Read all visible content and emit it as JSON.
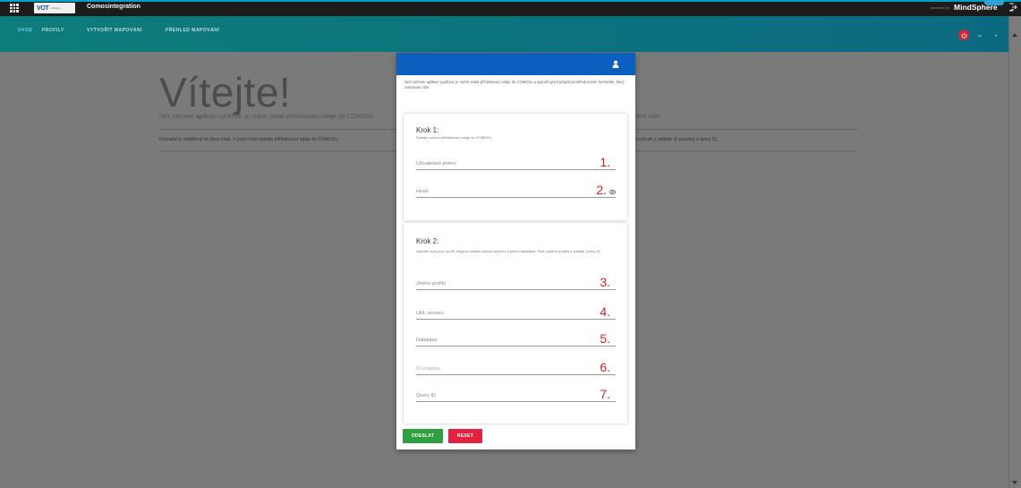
{
  "app": {
    "title": "Comosintegration",
    "logo_text": "VOT",
    "logo_sub": "software",
    "powered_by": "powered by",
    "brand": "MindSphere"
  },
  "nav": {
    "tabs": [
      {
        "label": "ÚVOD",
        "active": true
      },
      {
        "label": "PROFILY",
        "active": false
      },
      {
        "label": "VYTVOŘIT MAPOVÁNÍ",
        "active": false
      },
      {
        "label": "PŘEHLED MAPOVÁNÍ",
        "active": false
      }
    ],
    "language": "cs",
    "language_caret": "▾"
  },
  "background": {
    "heading": "Vítejte!",
    "intro_left": "Než začnete aplikaci využívat, je nutné zadat přihlašovací údaje do COMOSu",
    "intro_right": "nete níže.",
    "form_left": "Formulář je rozdělený do dvou částí. V první části zadejte přihlašovací údaje do COMOSu",
    "form_right": "a vyberte z zadejte ID projektu a query ID."
  },
  "modal": {
    "description": "Než začnete aplikaci využívat, je nutné zadat přihlašovací údaje do COMOSu a vytvořit první projekt prostřednictvím formuláře, který naleznete níže.",
    "step1": {
      "title": "Krok 1:",
      "subtitle": "Zadejte prosím přihlašovací údaje do COMOSu",
      "fields": [
        {
          "placeholder": "Uživatelské jméno",
          "number": "1."
        },
        {
          "placeholder": "Heslo",
          "number": "2."
        }
      ]
    },
    "step2": {
      "title": "Krok 2:",
      "subtitle": "Vytvořte svůj první profil. Nejprve zadejte adresu serveru a jméno databáze. Poté vyberte projekt a zadejte Query ID.",
      "fields": [
        {
          "placeholder": "Jméno profilu",
          "number": "3."
        },
        {
          "placeholder": "URL serveru",
          "number": "4."
        },
        {
          "placeholder": "Databáze",
          "number": "5."
        },
        {
          "placeholder": "ID projektu",
          "number": "6."
        },
        {
          "placeholder": "Query ID",
          "number": "7."
        }
      ]
    },
    "submit_label": "ODESLAT",
    "reset_label": "RESET"
  },
  "colors": {
    "topbar": "#1c1c1c",
    "navbar": "#0d7d7b",
    "modal_header": "#0a5fbf",
    "submit": "#2e9e3e",
    "reset": "#e3223f",
    "step_numbers": "#e01f22"
  },
  "icons": {
    "app_launcher": "grid-icon",
    "logout": "logout-icon",
    "power": "power-icon",
    "user": "user-icon",
    "password_toggle": "eye-icon"
  }
}
